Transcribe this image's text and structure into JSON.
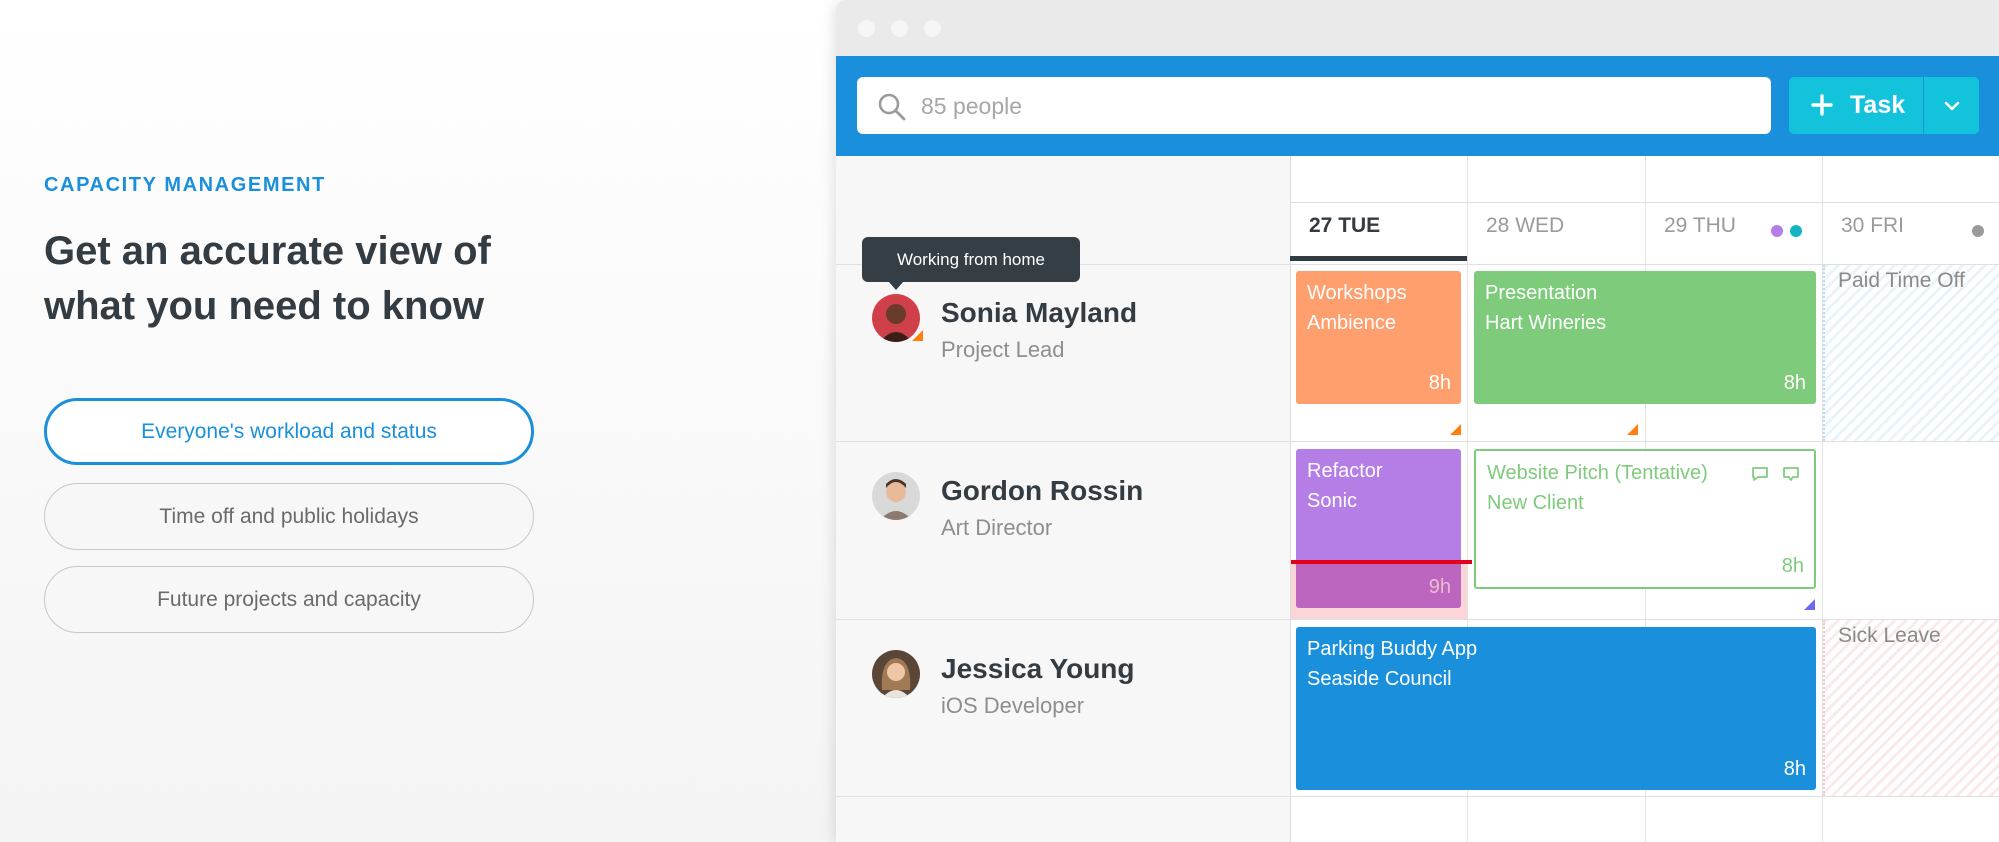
{
  "marketing": {
    "eyebrow": "CAPACITY MANAGEMENT",
    "headline": "Get an accurate view of what you need to know",
    "options": [
      "Everyone's workload and status",
      "Time off and public holidays",
      "Future projects and capacity"
    ]
  },
  "toolbar": {
    "search_placeholder": "85 people",
    "task_label": "Task"
  },
  "days": [
    {
      "label": "27 TUE",
      "active": true
    },
    {
      "label": "28 WED",
      "active": false
    },
    {
      "label": "29 THU",
      "active": false
    },
    {
      "label": "30 FRI",
      "active": false
    }
  ],
  "colors": {
    "brand": "#1a8fdb",
    "accent": "#13c2db",
    "orange": "#ff9f6e",
    "green": "#7ecb7b",
    "purple": "#b57de6",
    "blue": "#1a8fdb",
    "over_capacity": "#e3001b"
  },
  "tooltip": "Working from home",
  "people": [
    {
      "name": "Sonia Mayland",
      "role": "Project Lead",
      "tasks": [
        {
          "line1": "Workshops",
          "line2": "Ambience",
          "hours": "8h"
        },
        {
          "line1": "Presentation",
          "line2": "Hart Wineries",
          "hours": "8h"
        }
      ],
      "time_off": "Paid Time Off"
    },
    {
      "name": "Gordon Rossin",
      "role": "Art Director",
      "tasks": [
        {
          "line1": "Refactor",
          "line2": "Sonic",
          "hours": "9h"
        },
        {
          "line1": "Website Pitch (Tentative)",
          "line2": "New Client",
          "hours": "8h"
        }
      ]
    },
    {
      "name": "Jessica Young",
      "role": "iOS Developer",
      "tasks": [
        {
          "line1": "Parking Buddy App",
          "line2": "Seaside Council",
          "hours": "8h"
        }
      ],
      "time_off": "Sick Leave"
    }
  ]
}
